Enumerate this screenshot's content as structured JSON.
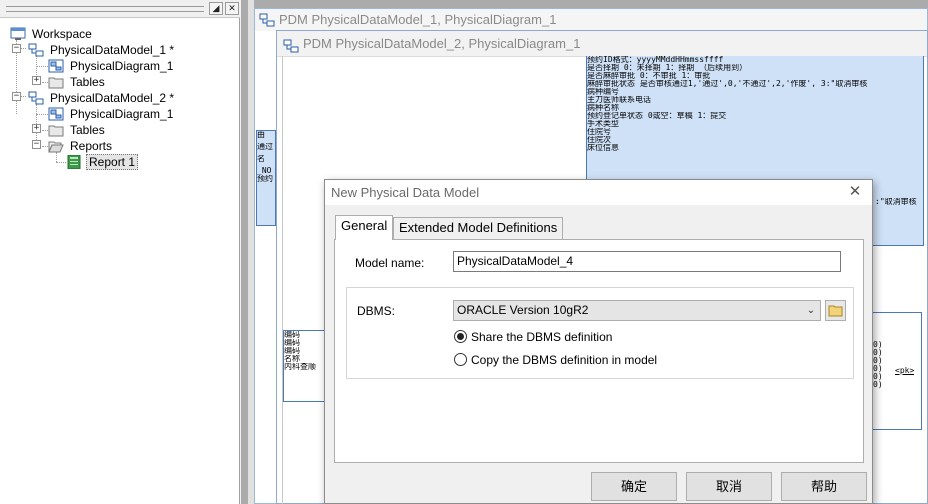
{
  "workspace": {
    "tree": [
      {
        "label": "Workspace",
        "icon": "workspace-icon"
      },
      {
        "label": "PhysicalDataModel_1 *",
        "icon": "pdm-model-icon"
      },
      {
        "label": "PhysicalDiagram_1",
        "icon": "diagram-icon"
      },
      {
        "label": "Tables",
        "icon": "folder-icon"
      },
      {
        "label": "PhysicalDataModel_2 *",
        "icon": "pdm-model-icon"
      },
      {
        "label": "PhysicalDiagram_1",
        "icon": "diagram-icon"
      },
      {
        "label": "Tables",
        "icon": "folder-icon"
      },
      {
        "label": "Reports",
        "icon": "folder-icon"
      },
      {
        "label": "Report 1",
        "icon": "report-icon"
      }
    ]
  },
  "windows": {
    "back_title": "PDM PhysicalDataModel_1, PhysicalDiagram_1",
    "front_title": "PDM PhysicalDataModel_2, PhysicalDiagram_1"
  },
  "diagram": {
    "top_entity_lines": [
      "预约ID格式：yyyyMMddHHmmssffff",
      "是否择期  0：未择期 1：择期  （后续用到）",
      "是否麻醉审批 0：不审批 1：审批",
      "麻醉审批状态  是否审核通过1,'通过',0,'不通过',2,'作废', 3:\"取消审核",
      "病种编号",
      "主刀医师联系电话",
      "病种名称",
      "预约登记单状态 0或空：草稿 1：提交",
      "手术类型",
      "住院号",
      "住院次",
      "床位信息"
    ],
    "top_entity_partial": ":\"取消审核",
    "left_fragment_lines": [
      "由",
      "通过",
      "名",
      "_NO",
      "预约"
    ],
    "lower_left_lines": [
      "编码",
      "编码",
      "编码",
      "名称",
      "内科查顺"
    ],
    "lower_right_lines": [
      "0)",
      "0)",
      "0)",
      "0)",
      "0)",
      "0)"
    ],
    "pk_label": "<pk>"
  },
  "dialog": {
    "title": "New Physical Data Model",
    "tabs": [
      "General",
      "Extended Model Definitions"
    ],
    "model_name_label": "Model name:",
    "model_name_value": "PhysicalDataModel_4",
    "dbms_label": "DBMS:",
    "dbms_value": "ORACLE Version 10gR2",
    "radio_options": [
      {
        "label": "Share the DBMS definition",
        "checked": true
      },
      {
        "label": "Copy the DBMS definition in model",
        "checked": false
      }
    ],
    "buttons": {
      "ok": "确定",
      "cancel": "取消",
      "help": "帮助"
    }
  }
}
